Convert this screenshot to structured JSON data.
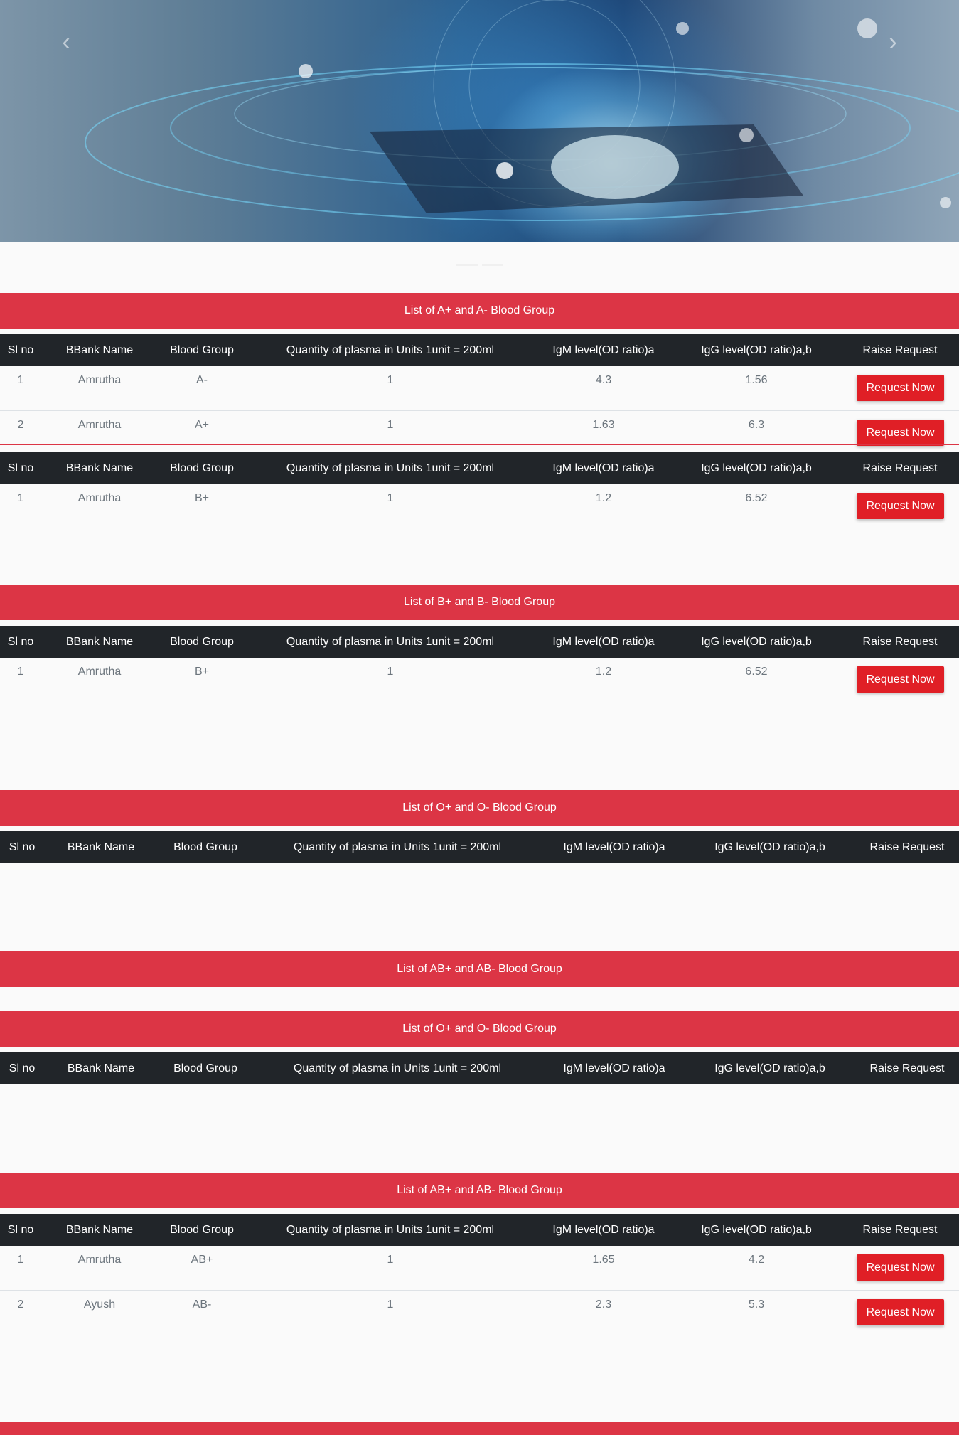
{
  "hero": {
    "prev_icon": "chevron-left-icon",
    "next_icon": "chevron-right-icon",
    "prev_glyph": "‹",
    "next_glyph": "›"
  },
  "colors": {
    "accent": "#dc3545",
    "header_dark": "#212529",
    "button_red": "#e01f26"
  },
  "headers": [
    "Sl no",
    "BBank Name",
    "Blood Group",
    "Quantity of plasma in Units 1unit = 200ml",
    "IgM level(OD ratio)a",
    "IgG level(OD ratio)a,b",
    "Raise Request"
  ],
  "button_label": "Request Now",
  "sections": [
    {
      "title": "List of A+ and A- Blood Group",
      "tables": [
        {
          "rows": [
            [
              "1",
              "Amrutha",
              "A-",
              "1",
              "4.3",
              "1.56"
            ],
            [
              "2",
              "Amrutha",
              "A+",
              "1",
              "1.63",
              "6.3"
            ]
          ]
        },
        {
          "rows": [
            [
              "1",
              "Amrutha",
              "B+",
              "1",
              "1.2",
              "6.52"
            ]
          ]
        }
      ]
    },
    {
      "title": "List of B+ and B- Blood Group",
      "tables": [
        {
          "rows": [
            [
              "1",
              "Amrutha",
              "B+",
              "1",
              "1.2",
              "6.52"
            ]
          ]
        }
      ]
    },
    {
      "title": "List of O+ and O- Blood Group",
      "tables": [
        {
          "rows": []
        }
      ]
    },
    {
      "title": "List of AB+ and AB- Blood Group",
      "tables": []
    },
    {
      "title": "List of O+ and O- Blood Group",
      "tables": [
        {
          "rows": []
        }
      ]
    },
    {
      "title": "List of AB+ and AB- Blood Group",
      "tables": [
        {
          "rows": [
            [
              "1",
              "Amrutha",
              "AB+",
              "1",
              "1.65",
              "4.2"
            ],
            [
              "2",
              "Ayush",
              "AB-",
              "1",
              "2.3",
              "5.3"
            ]
          ]
        }
      ]
    }
  ]
}
